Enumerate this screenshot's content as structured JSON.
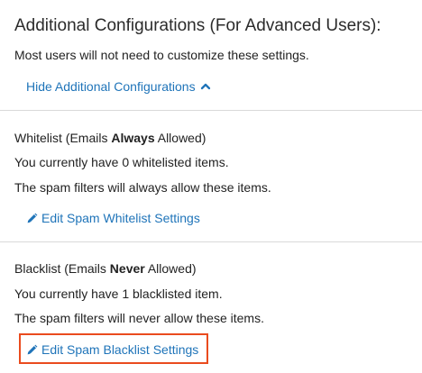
{
  "header": {
    "title": "Additional Configurations (For Advanced Users):",
    "subtitle": "Most users will not need to customize these settings.",
    "hide_link": "Hide Additional Configurations"
  },
  "whitelist": {
    "title_prefix": "Whitelist (Emails ",
    "title_bold": "Always",
    "title_suffix": " Allowed)",
    "count_text": "You currently have 0 whitelisted items.",
    "description": "The spam filters will always allow these items.",
    "edit_link": "Edit Spam Whitelist Settings"
  },
  "blacklist": {
    "title_prefix": "Blacklist (Emails ",
    "title_bold": "Never",
    "title_suffix": " Allowed)",
    "count_text": "You currently have 1 blacklisted item.",
    "description": "The spam filters will never allow these items.",
    "edit_link": "Edit Spam Blacklist Settings"
  },
  "icons": {
    "hide_chevron": "chevron-up-icon",
    "edit": "pencil-icon"
  },
  "colors": {
    "link": "#1f74b9",
    "highlight": "#ea4b1e",
    "divider": "#d9d9d9"
  }
}
